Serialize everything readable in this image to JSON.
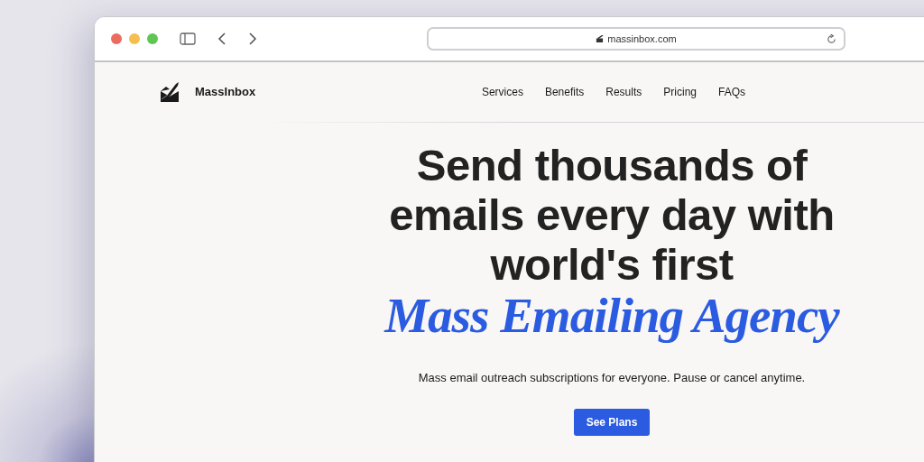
{
  "browser": {
    "url": "massinbox.com"
  },
  "nav": {
    "brand": "MassInbox",
    "links": [
      "Services",
      "Benefits",
      "Results",
      "Pricing",
      "FAQs"
    ]
  },
  "hero": {
    "headline_lines": [
      "Send thousands of",
      "emails every day with",
      "world's first"
    ],
    "highlight": "Mass Emailing Agency",
    "subtitle": "Mass email outreach subscriptions for everyone. Pause or cancel anytime.",
    "cta": "See Plans"
  }
}
